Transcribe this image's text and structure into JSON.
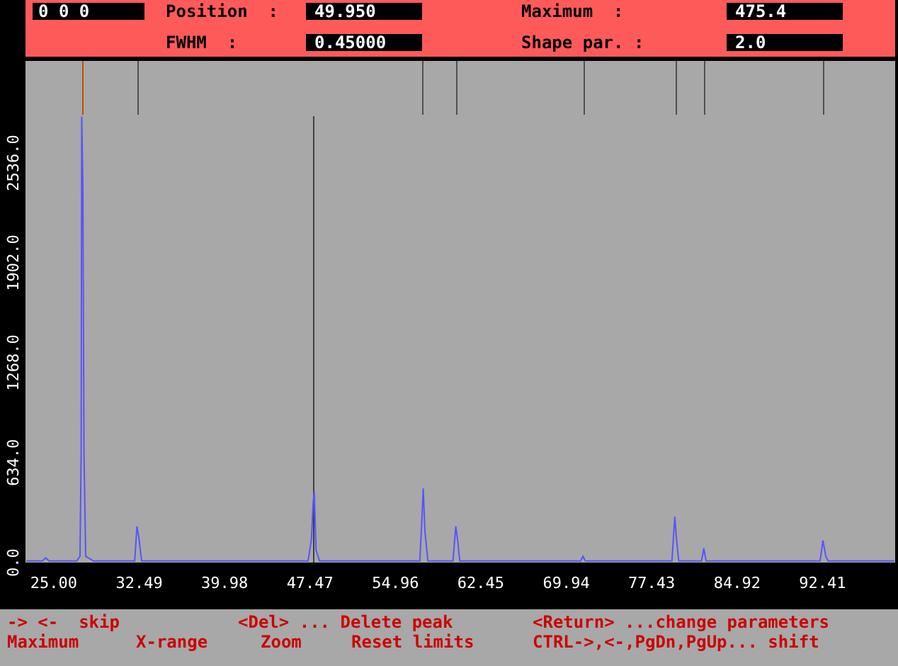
{
  "header": {
    "counter": "0 0 0",
    "fields": [
      {
        "label": "Position  :",
        "value": "49.950"
      },
      {
        "label": "Maximum  :",
        "value": "475.4"
      },
      {
        "label": "FWHM  :",
        "value": "0.45000"
      },
      {
        "label": "Shape par. :",
        "value": "2.0"
      }
    ]
  },
  "plot": {
    "chart_data": {
      "type": "line",
      "xlim": [
        22.52,
        98.78
      ],
      "ylim": [
        0,
        3183
      ],
      "xticks": [
        {
          "value": 25,
          "label": "25.00"
        },
        {
          "value": 32.49,
          "label": "32.49"
        },
        {
          "value": 39.98,
          "label": "39.98"
        },
        {
          "value": 47.47,
          "label": "47.47"
        },
        {
          "value": 54.96,
          "label": "54.96"
        },
        {
          "value": 62.45,
          "label": "62.45"
        },
        {
          "value": 69.94,
          "label": "69.94"
        },
        {
          "value": 77.43,
          "label": "77.43"
        },
        {
          "value": 84.92,
          "label": "84.92"
        },
        {
          "value": 92.41,
          "label": "92.41"
        }
      ],
      "yticks": [
        {
          "value": 0,
          "label": "0.0"
        },
        {
          "value": 634,
          "label": "634.0"
        },
        {
          "value": 1268,
          "label": "1268.0"
        },
        {
          "value": 1902,
          "label": "1902.0"
        },
        {
          "value": 2536,
          "label": "2536.0"
        }
      ],
      "x": [
        22.6,
        24.0,
        24.3,
        24.6,
        27.0,
        27.3,
        27.4,
        27.45,
        27.55,
        27.65,
        27.8,
        28.5,
        32.1,
        32.3,
        32.45,
        32.7,
        47.3,
        47.6,
        47.75,
        47.85,
        48.0,
        48.3,
        57.1,
        57.3,
        57.4,
        57.55,
        57.8,
        60.0,
        60.25,
        60.4,
        60.6,
        71.2,
        71.4,
        71.6,
        79.2,
        79.45,
        79.6,
        79.8,
        81.8,
        82.0,
        82.2,
        92.2,
        92.45,
        92.7,
        92.9,
        98.7
      ],
      "series": [
        {
          "color": "#5555ff",
          "values": [
            10,
            10,
            30,
            10,
            10,
            40,
            700,
            2830,
            2400,
            700,
            40,
            10,
            10,
            230,
            160,
            10,
            10,
            150,
            380,
            450,
            80,
            10,
            10,
            300,
            470,
            200,
            10,
            10,
            230,
            150,
            10,
            10,
            40,
            10,
            10,
            290,
            150,
            10,
            10,
            90,
            10,
            10,
            140,
            40,
            10,
            10
          ]
        }
      ],
      "ref_lines": [
        {
          "axis": "x",
          "value": 27.48,
          "color": "#c05000"
        },
        {
          "axis": "x",
          "value": 32.33,
          "color": "#505050"
        },
        {
          "axis": "x",
          "value": 47.73,
          "color": "#404040"
        },
        {
          "axis": "x",
          "value": 57.3,
          "color": "#505050"
        },
        {
          "axis": "x",
          "value": 60.3,
          "color": "#505050"
        },
        {
          "axis": "x",
          "value": 71.4,
          "color": "#505050"
        },
        {
          "axis": "x",
          "value": 79.5,
          "color": "#505050"
        },
        {
          "axis": "x",
          "value": 82.0,
          "color": "#505050"
        },
        {
          "axis": "x",
          "value": 92.5,
          "color": "#505050"
        }
      ]
    }
  },
  "help": [
    [
      "-> <-  skip",
      "<Del> ... Delete peak",
      "<Return> ...change parameters"
    ],
    [
      "Maximum",
      "X-range",
      "Zoom",
      "Reset limits",
      "CTRL->,<-,PgDn,PgUp... shift"
    ]
  ]
}
